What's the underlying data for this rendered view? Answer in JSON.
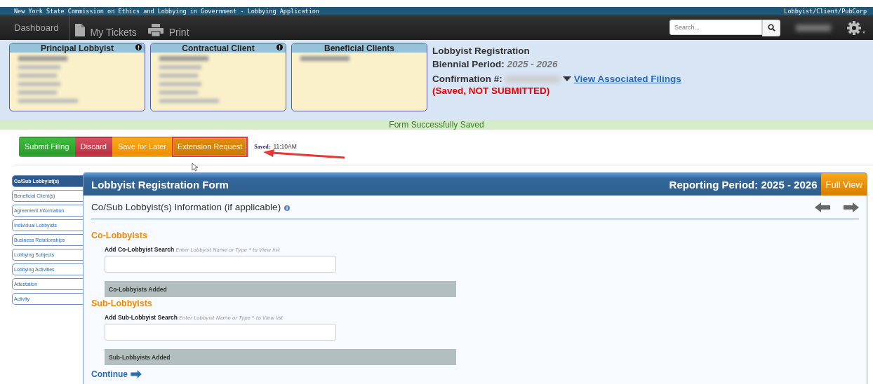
{
  "title_bar": {
    "title": "New York State Commission on Ethics and Lobbying in Government - Lobbying Application",
    "role": "Lobbyist/Client/PubCorp"
  },
  "nav": {
    "items": [
      {
        "label": "Dashboard"
      },
      {
        "label": "My Tickets"
      },
      {
        "label": "Print"
      }
    ],
    "search": {
      "placeholder": "Search..."
    }
  },
  "cards": [
    {
      "title": "Principal Lobbyist",
      "alert": true
    },
    {
      "title": "Contractual Client",
      "alert": true
    },
    {
      "title": "Beneficial Clients",
      "alert": false
    }
  ],
  "filing": {
    "type": "Lobbyist Registration",
    "period_label": "Biennial Period:",
    "period": "2025 - 2026",
    "confirmation_label": "Confirmation #:",
    "link": "View Associated Filings",
    "status": "(Saved, NOT SUBMITTED)"
  },
  "notice": "Form Successfully Saved",
  "actions": [
    {
      "label": "Submit Filing",
      "kind": "success",
      "highlighted": false
    },
    {
      "label": "Discard",
      "kind": "danger",
      "highlighted": false
    },
    {
      "label": "Save for Later",
      "kind": "warning",
      "highlighted": false
    },
    {
      "label": "Extension Request",
      "kind": "warning-dark",
      "highlighted": true
    }
  ],
  "saved": {
    "label": "Saved:",
    "time": "11:10AM"
  },
  "sidebar": {
    "items": [
      {
        "label": "Co/Sub Lobbyist(s)",
        "selected": true
      },
      {
        "label": "Beneficial Client(s)",
        "selected": false
      },
      {
        "label": "Agreement Information",
        "selected": false
      },
      {
        "label": "Individual Lobbyists",
        "selected": false
      },
      {
        "label": "Business Relationships",
        "selected": false
      },
      {
        "label": "Lobbying Subjects",
        "selected": false
      },
      {
        "label": "Lobbying Activities",
        "selected": false
      },
      {
        "label": "Attestation",
        "selected": false
      },
      {
        "label": "Activity",
        "selected": false
      }
    ]
  },
  "form": {
    "title": "Lobbyist Registration Form",
    "reporting_period": "Reporting Period: 2025 - 2026",
    "full_view": "Full View",
    "section": "Co/Sub Lobbyist(s) Information (if applicable)",
    "groups": [
      {
        "heading": "Co-Lobbyists",
        "search_label": "Add Co-Lobbyist Search",
        "hint": "Enter Lobbyist Name or Type * to View list",
        "added": "Co-Lobbyists Added"
      },
      {
        "heading": "Sub-Lobbyists",
        "search_label": "Add Sub-Lobbyist Search",
        "hint": "Enter Lobbyist Name or Type * to View list",
        "added": "Sub-Lobbyists Added"
      }
    ],
    "continue": "Continue"
  }
}
